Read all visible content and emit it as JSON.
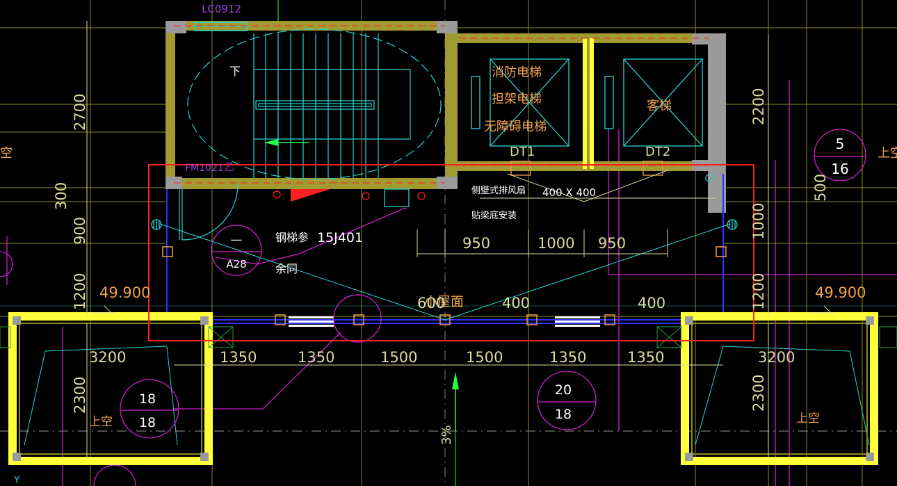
{
  "colors": {
    "background": "#000000",
    "wall_yellow": "#ffff3a",
    "wall_gray": "#9a9a9a",
    "cyan": "#2ad4d4",
    "magenta": "#d020d0",
    "green": "#20ff40",
    "red": "#ff2020",
    "dim_text": "#dcdca0",
    "orange_text": "#f0a050",
    "blue": "#3030ff",
    "olive": "#a09a30"
  },
  "labels": {
    "window_tag": "LC0912",
    "down_arrow": "下",
    "door_tag": "FM1021",
    "door_tag_suffix": "乙",
    "elevator_1_lines": [
      "消防电梯",
      "担架电梯",
      "无障碍电梯"
    ],
    "elevator_2": "客梯",
    "dt1": "DT1",
    "dt2": "DT2",
    "fan_note_1": "侧壁式排风扇",
    "fan_note_2": "贴梁底安装",
    "fan_size": "400 X 400",
    "stair_ref_1": "钢梯参",
    "stair_ref_code": "15J401",
    "stair_ref_2": "余同",
    "roof_label": "小屋面",
    "void_left": "上空",
    "void_right": "上空",
    "void_far_right": "上空",
    "edge_left": "空",
    "slope": "3%",
    "axis_y": "Y"
  },
  "callouts": {
    "a28_top": "—",
    "a28_bottom": "A28",
    "right_top": "5",
    "right_bottom": "16",
    "left_top": "18",
    "left_bottom": "18",
    "center_top": "20",
    "center_bottom": "18"
  },
  "dimensions": {
    "left_vertical": [
      "2700",
      "300",
      "900",
      "1200",
      "2300"
    ],
    "right_vertical": [
      "2200",
      "500",
      "1000",
      "1200",
      "2300"
    ],
    "elevation_left": "49.900",
    "elevation_right": "49.900",
    "top_row": [
      "950",
      "1000",
      "950"
    ],
    "mid_row": [
      "600",
      "400",
      "400"
    ],
    "bottom_row": [
      "3200",
      "1350",
      "1350",
      "1500",
      "1500",
      "1350",
      "1350",
      "3200"
    ]
  }
}
